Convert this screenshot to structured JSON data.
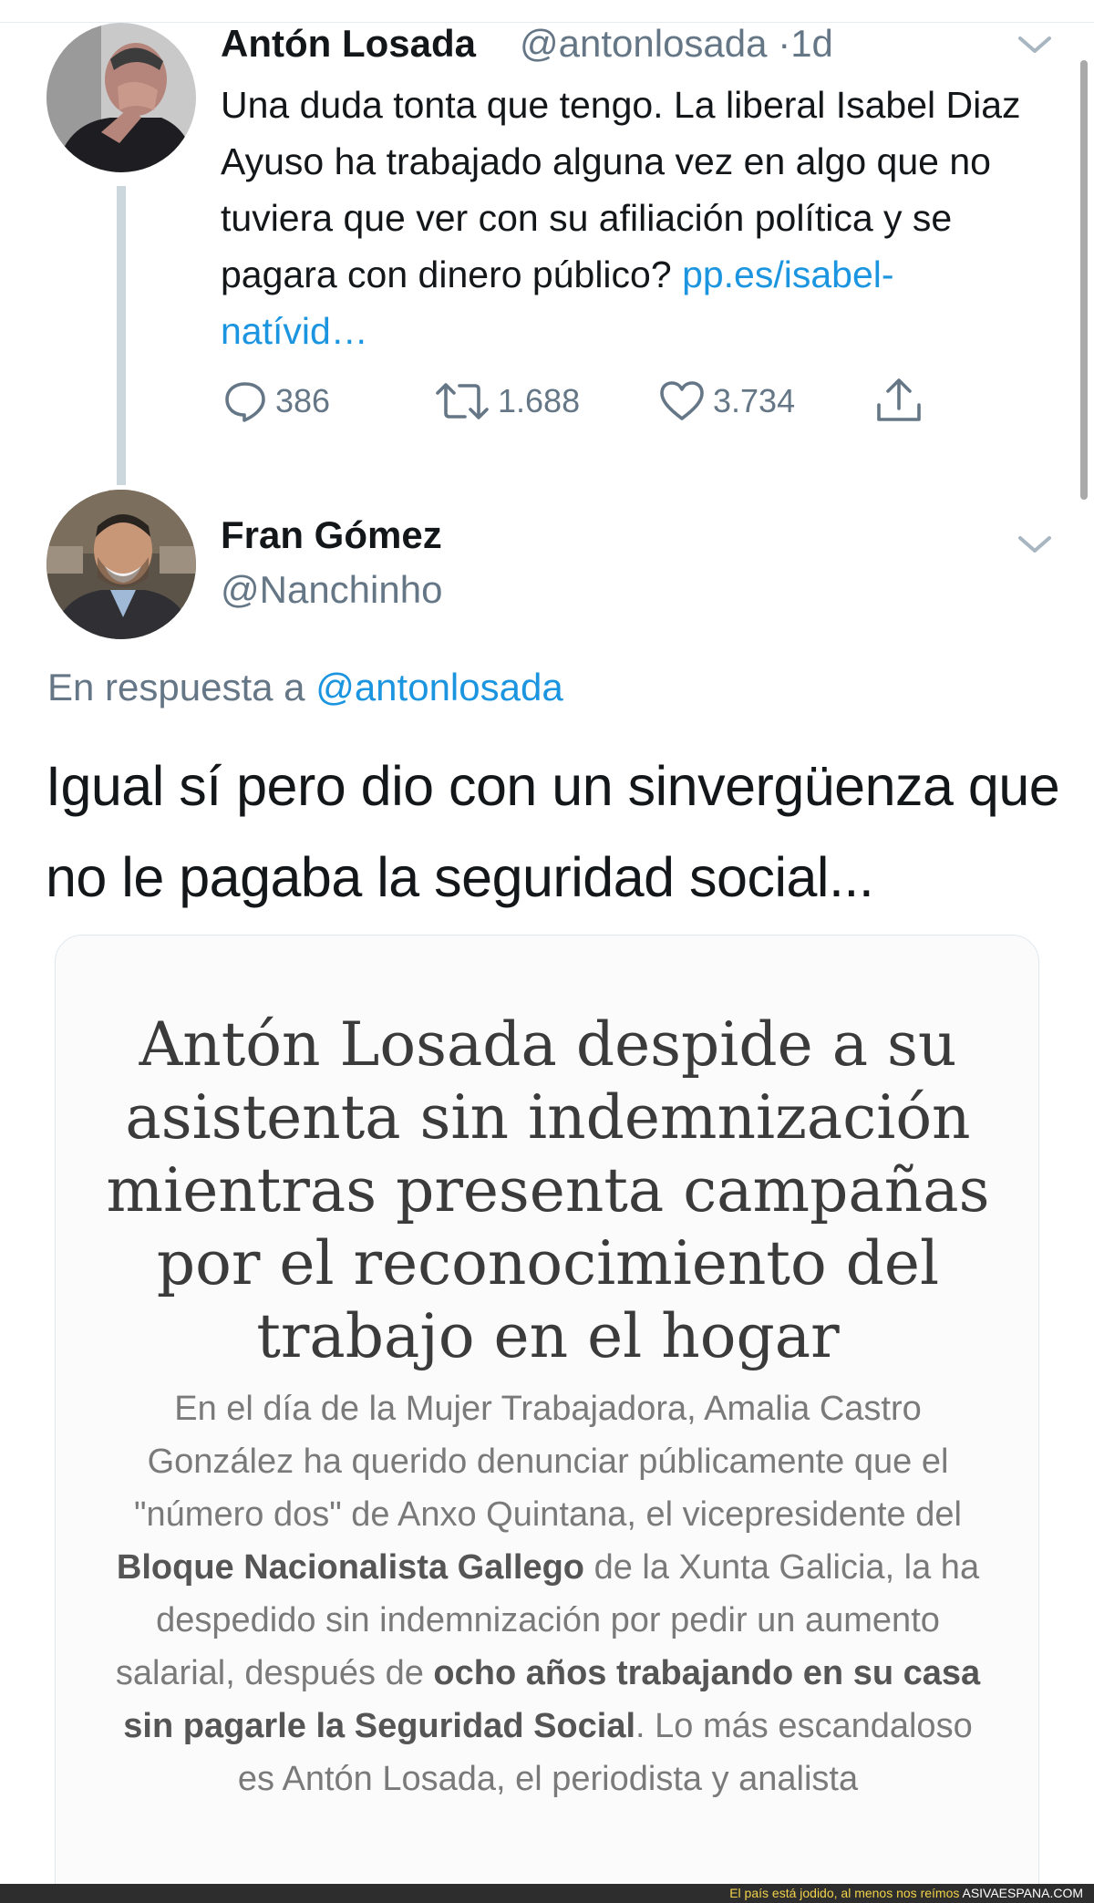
{
  "tweet": {
    "author_name": "Antón Losada",
    "author_handle": "@antonlosada",
    "separator": "·",
    "time": "1d",
    "text": "Una duda tonta que tengo. La liberal Isabel Diaz Ayuso ha trabajado alguna vez en algo que no tuviera que ver con su afiliación política y se pagara con dinero público?",
    "link_text": "pp.es/isabel-natívid…",
    "actions": {
      "replies": "386",
      "retweets": "1.688",
      "likes": "3.734"
    }
  },
  "reply": {
    "author_name": "Fran Gómez",
    "author_handle": "@Nanchinho",
    "reply_to_prefix": "En respuesta a",
    "reply_to_handle": "@antonlosada",
    "text": "Igual sí pero dio con un sinvergüenza que no le pagaba la seguridad social...",
    "card": {
      "headline": "Antón Losada despide a su asistenta sin indemnización mientras presenta campañas por el reconocimiento del trabajo en el hogar",
      "excerpt": [
        {
          "text": "En el día de la Mujer Trabajadora, Amalia Castro González ha querido denunciar públicamente que el \"número dos\" de Anxo Quintana, el vicepresidente del ",
          "bold": false
        },
        {
          "text": "Bloque Nacionalista Gallego",
          "bold": true
        },
        {
          "text": " de la Xunta Galicia, la ha despedido sin indemnización por pedir un aumento salarial, después de ",
          "bold": false
        },
        {
          "text": "ocho años trabajando en su casa sin pagarle la Seguridad Social",
          "bold": true
        },
        {
          "text": ". Lo más escandaloso es Antón Losada, el periodista y analista",
          "bold": false
        }
      ]
    }
  },
  "footer": {
    "caption": "El país está jodido, al menos nos reímos",
    "site": "ASIVAESPANA.COM"
  },
  "icons": {
    "reply": "speech-bubble-icon",
    "retweet": "retweet-arrows-icon",
    "like": "heart-outline-icon",
    "share": "share-upload-icon",
    "menu": "chevron-down-icon"
  },
  "colors": {
    "link": "#1b95e0",
    "secondary_text": "#657786",
    "thread_line": "#ccd6dd",
    "footer_caption": "#f2d24a"
  }
}
